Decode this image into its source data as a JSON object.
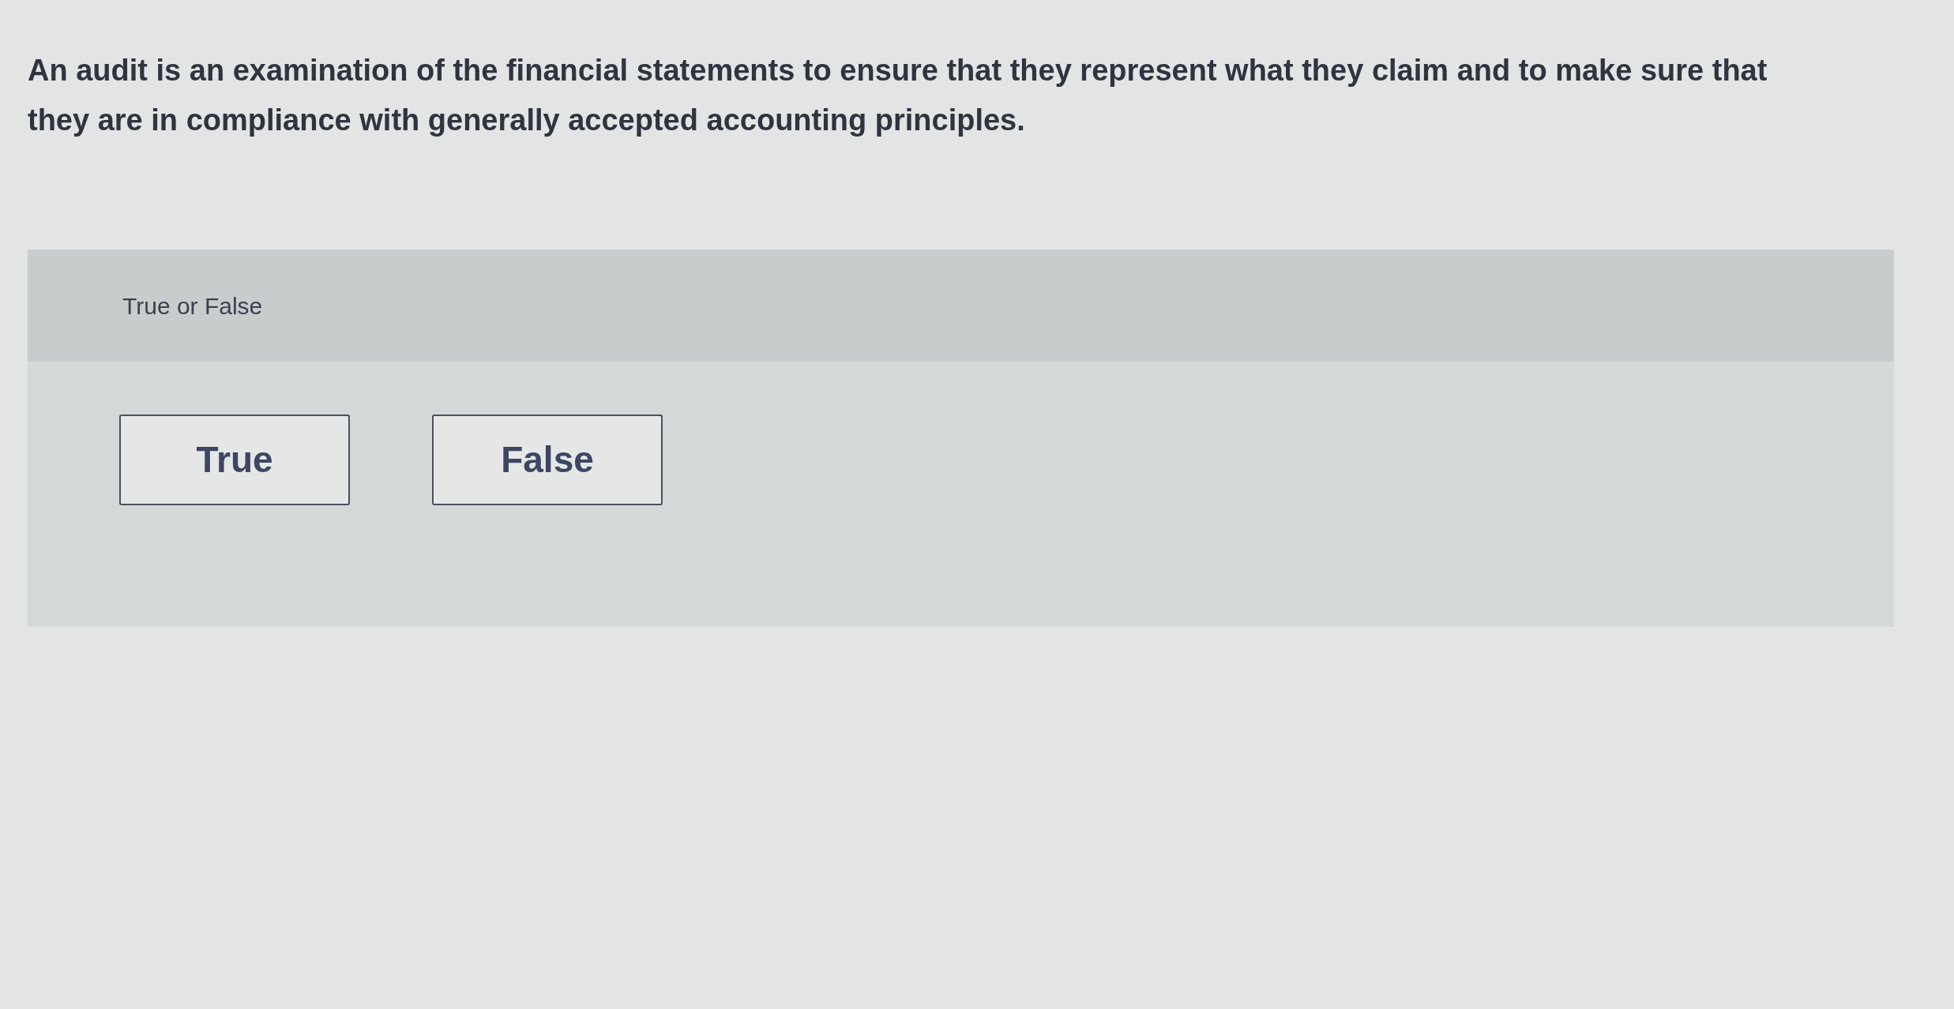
{
  "question": {
    "text": "An audit is an examination of the financial statements to ensure that they represent what they claim and to make sure that they are in compliance with generally accepted accounting principles."
  },
  "answer_area": {
    "prompt": "True or False",
    "options": [
      {
        "label": "True",
        "selected": false
      },
      {
        "label": "False",
        "selected": false
      }
    ]
  }
}
